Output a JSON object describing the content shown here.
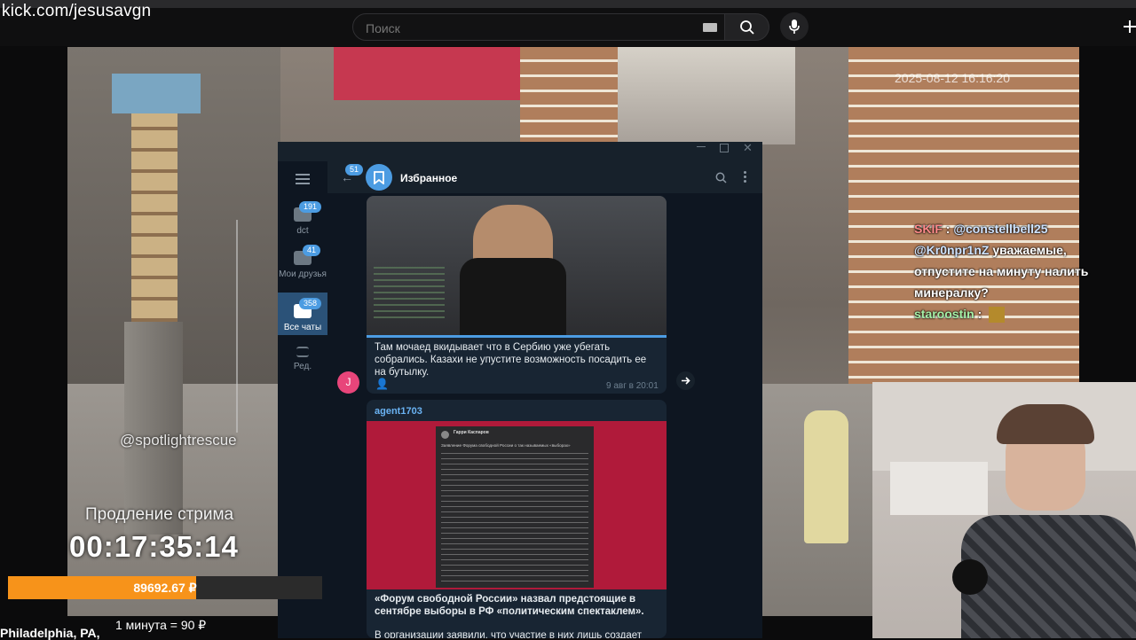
{
  "browser": {
    "stream_url": "kick.com/jesusavgn",
    "search_placeholder": "Поиск"
  },
  "stream": {
    "watermark": "@spotlightrescue",
    "timestamp": "2025-08-12 16:16:20",
    "extension_label": "Продление стрима",
    "extension_timer": "00:17:35:14",
    "donation_amount": "89692.67 ₽",
    "donation_progress_fraction": 0.6,
    "price_line": "1 минута = 90 ₽",
    "location": "Philadelphia, PA,"
  },
  "telegram": {
    "back_badge": "51",
    "chat_title": "Избранное",
    "sidebar": [
      {
        "label": "dct",
        "badge": "191"
      },
      {
        "label": "Мои друзья",
        "badge": "41"
      },
      {
        "label": "Все чаты",
        "badge": "358"
      },
      {
        "label": "Ред.",
        "badge": ""
      }
    ],
    "messages": [
      {
        "text": "Там мочаед вкидывает что в Сербию уже убегать собрались. Казахи не упустите возможность посадить ее на бутылку.",
        "time": "9 авг в 20:01",
        "avatar_letter": "J"
      },
      {
        "author": "agent1703",
        "embedded_author": "Гарри Каспаров",
        "embedded_title": "Заявление Форума свободной России о так называемых «выборах»",
        "text": "«Форум свободной России» назвал предстоящие в сентябре выборы в РФ «политическим спектаклем».",
        "text_cut": "В организации заявили, что участие в них лишь создает"
      }
    ]
  },
  "chat": [
    {
      "user": "SKIF",
      "mention": "@constellbell25",
      "text": ""
    },
    {
      "user": "",
      "mention": "@Kr0npr1nZ",
      "text": "уважаемые, отпустите на минуту налить минералку?"
    },
    {
      "user": "staroostin",
      "mention": "",
      "text": ":"
    }
  ],
  "colors": {
    "accent_orange": "#f7931a",
    "telegram_bg": "#0e1621",
    "telegram_accent": "#4c9ce2"
  }
}
